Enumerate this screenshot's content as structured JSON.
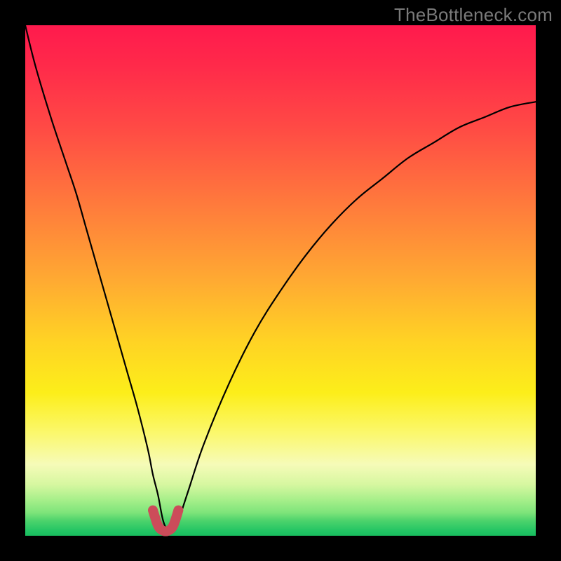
{
  "watermark": {
    "text": "TheBottleneck.com"
  },
  "colors": {
    "background": "#000000",
    "curve_main": "#000000",
    "curve_highlight": "#cc4c5a"
  },
  "chart_data": {
    "type": "line",
    "title": "",
    "xlabel": "",
    "ylabel": "",
    "xlim": [
      0,
      100
    ],
    "ylim": [
      0,
      100
    ],
    "grid": false,
    "legend": false,
    "series": [
      {
        "name": "bottleneck-curve",
        "x": [
          0,
          2,
          5,
          8,
          10,
          12,
          14,
          16,
          18,
          20,
          22,
          24,
          25,
          26,
          27,
          28,
          29,
          30,
          32,
          35,
          40,
          45,
          50,
          55,
          60,
          65,
          70,
          75,
          80,
          85,
          90,
          95,
          100
        ],
        "values": [
          100,
          92,
          82,
          73,
          67,
          60,
          53,
          46,
          39,
          32,
          25,
          17,
          12,
          8,
          3,
          1,
          1,
          3,
          9,
          18,
          30,
          40,
          48,
          55,
          61,
          66,
          70,
          74,
          77,
          80,
          82,
          84,
          85
        ]
      },
      {
        "name": "optimal-region-highlight",
        "x": [
          25,
          26,
          27,
          28,
          29,
          30
        ],
        "values": [
          5,
          2,
          1,
          1,
          2,
          5
        ]
      }
    ],
    "minimum_at_x": 27.5
  }
}
